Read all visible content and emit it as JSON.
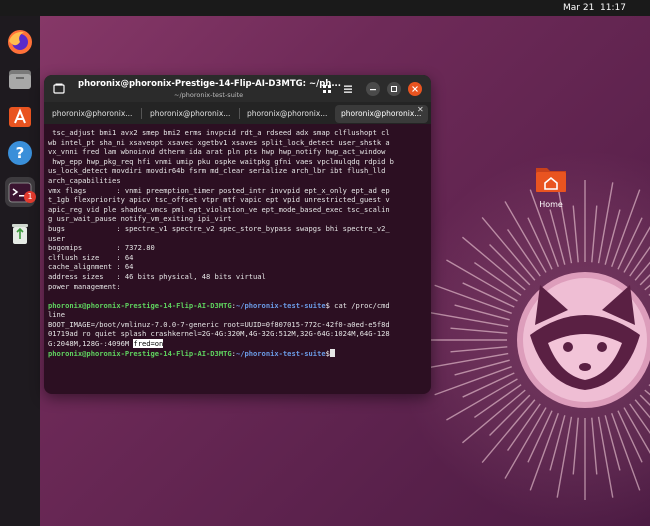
{
  "topbar": {
    "clock": "Mar 21  11:17"
  },
  "dock": {
    "apps": [
      {
        "name": "Firefox",
        "icon": "firefox-icon"
      },
      {
        "name": "Files",
        "icon": "files-icon"
      },
      {
        "name": "App Center",
        "icon": "app-center-icon"
      },
      {
        "name": "Help",
        "icon": "help-icon"
      },
      {
        "name": "Terminal",
        "icon": "terminal-icon",
        "badge": "1"
      },
      {
        "name": "Trash",
        "icon": "trash-icon"
      }
    ]
  },
  "terminal": {
    "title": "phoronix@phoronix-Prestige-14-Flip-AI-D3MTG: ~/ph...",
    "subtitle": "~/phoronix-test-suite",
    "tabs": [
      {
        "label": "phoronix@phoronix..."
      },
      {
        "label": "phoronix@phoronix..."
      },
      {
        "label": "phoronix@phoronix..."
      },
      {
        "label": "phoronix@phoronix...",
        "active": true
      }
    ],
    "lines": [
      " tsc_adjust bmi1 avx2 smep bmi2 erms invpcid rdt_a rdseed adx smap clflushopt cl",
      "wb intel_pt sha_ni xsaveopt xsavec xgetbv1 xsaves split_lock_detect user_shstk a",
      "vx_vnni fred lam wbnoinvd dtherm ida arat pln pts hwp hwp_notify hwp_act_window",
      " hwp_epp hwp_pkg_req hfi vnmi umip pku ospke waitpkg gfni vaes vpclmulqdq rdpid b",
      "us_lock_detect movdiri movdir64b fsrm md_clear serialize arch_lbr ibt flush_lld",
      "arch_capabilities",
      "vmx flags       : vnmi preemption_timer posted_intr invvpid ept_x_only ept_ad ep",
      "t_1gb flexpriority apicv tsc_offset vtpr mtf vapic ept vpid unrestricted_guest v",
      "apic_reg vid ple shadow_vmcs pml ept_violation_ve ept_mode_based_exec tsc_scalin",
      "g usr_wait_pause notify_vm_exiting ipi_virt",
      "bugs            : spectre_v1 spectre_v2 spec_store_bypass swapgs bhi spectre_v2_",
      "user",
      "bogomips        : 7372.80",
      "clflush size    : 64",
      "cache_alignment : 64",
      "address sizes   : 46 bits physical, 48 bits virtual",
      "power management:",
      ""
    ],
    "prompt_user": "phoronix@phoronix-Prestige-14-Flip-AI-D3MTG",
    "prompt_sep": ":",
    "prompt_path": "~/phoronix-test-suite",
    "prompt_dollar": "$",
    "command": " cat /proc/cmd",
    "command_wrap": "line",
    "cmdline_output": [
      "BOOT_IMAGE=/boot/vmlinuz-7.0.0-7-generic root=UUID=0f807015-772c-42f0-a0ed-e5f8d",
      "01719ad ro quiet splash crashkernel=2G-4G:320M,4G-32G:512M,32G-64G:1024M,64G-128",
      "G:2048M,128G-:4096M "
    ],
    "highlight": "fred=on"
  },
  "desktop": {
    "home_label": "Home"
  },
  "colors": {
    "prompt_user": "#5fd35f",
    "prompt_path": "#6b9be6",
    "terminal_bg": "#2c0f22",
    "accent_orange": "#e95420"
  }
}
